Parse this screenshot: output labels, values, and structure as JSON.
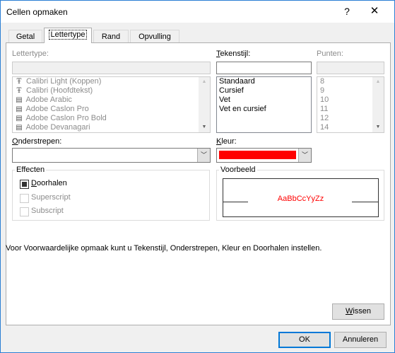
{
  "window": {
    "title": "Cellen opmaken",
    "help_glyph": "?",
    "close_glyph": "✕"
  },
  "tabs": [
    {
      "label": "Getal",
      "active": false
    },
    {
      "label": "Lettertype",
      "active": true
    },
    {
      "label": "Rand",
      "active": false
    },
    {
      "label": "Opvulling",
      "active": false
    }
  ],
  "font": {
    "label": "Lettertype:",
    "value": "",
    "items": [
      {
        "name": "Calibri Light (Koppen)",
        "icon": "truetype-icon"
      },
      {
        "name": "Calibri (Hoofdtekst)",
        "icon": "truetype-icon"
      },
      {
        "name": "Adobe Arabic",
        "icon": "opentype-icon"
      },
      {
        "name": "Adobe Caslon Pro",
        "icon": "opentype-icon"
      },
      {
        "name": "Adobe Caslon Pro Bold",
        "icon": "opentype-icon"
      },
      {
        "name": "Adobe Devanagari",
        "icon": "opentype-icon"
      }
    ]
  },
  "style": {
    "label": "Tekenstijl:",
    "value": "",
    "items": [
      "Standaard",
      "Cursief",
      "Vet",
      "Vet en cursief"
    ]
  },
  "size": {
    "label": "Punten:",
    "value": "",
    "items": [
      "8",
      "9",
      "10",
      "11",
      "12",
      "14"
    ]
  },
  "underline": {
    "label": "Onderstrepen:",
    "value": ""
  },
  "color": {
    "label": "Kleur:",
    "value_hex": "#ff0000"
  },
  "effects": {
    "legend": "Effecten",
    "items": [
      {
        "label": "Doorhalen",
        "checked": true,
        "enabled": true
      },
      {
        "label": "Superscript",
        "checked": false,
        "enabled": false
      },
      {
        "label": "Subscript",
        "checked": false,
        "enabled": false
      }
    ]
  },
  "preview": {
    "legend": "Voorbeeld",
    "sample_text": "AaBbCcYyZz",
    "sample_color": "#ff0000"
  },
  "info_text": "Voor Voorwaardelijke opmaak kunt u Tekenstijl, Onderstrepen, Kleur en Doorhalen instellen.",
  "buttons": {
    "clear": "Wissen",
    "ok": "OK",
    "cancel": "Annuleren"
  }
}
